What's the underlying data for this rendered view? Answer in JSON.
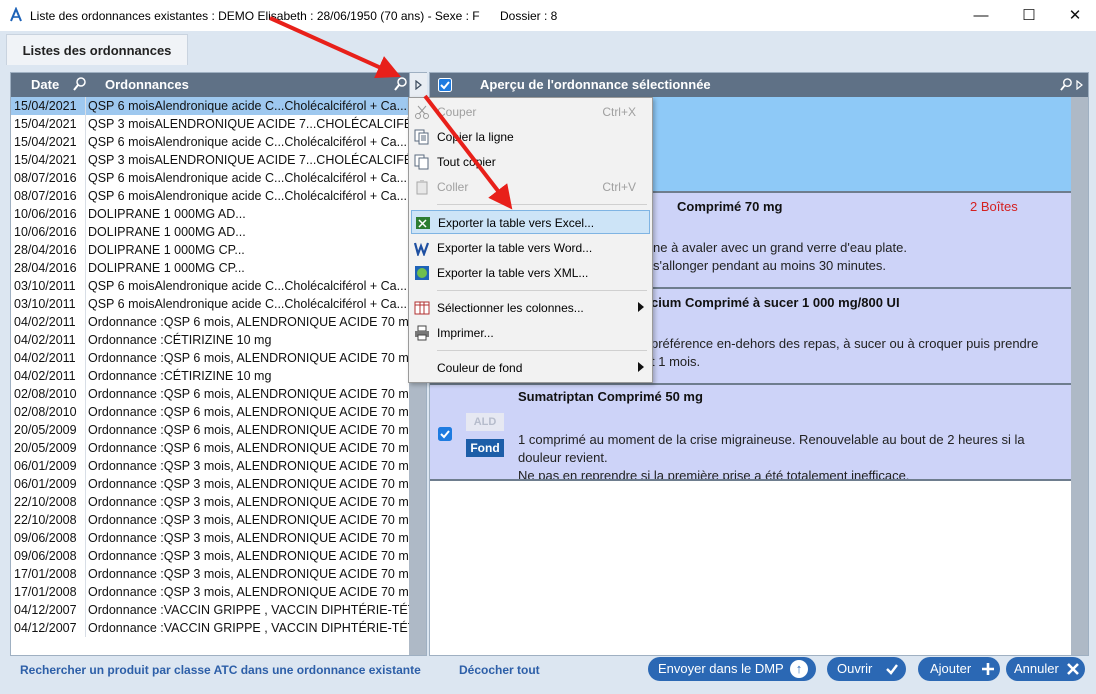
{
  "window": {
    "title": "Liste des ordonnances existantes : DEMO Elisabeth : 28/06/1950 (70 ans) - Sexe : F",
    "dossier": "Dossier : 8",
    "minimize": "—",
    "maximize": "☐",
    "close": "✕"
  },
  "tab": {
    "label": "Listes des ordonnances"
  },
  "left_table": {
    "col_date": "Date",
    "col_ordonnances": "Ordonnances",
    "rows": [
      {
        "date": "15/04/2021",
        "ord": "QSP 6 moisAlendronique acide C...Cholécalciférol + Ca..."
      },
      {
        "date": "15/04/2021",
        "ord": "QSP 3 moisALENDRONIQUE ACIDE 7...CHOLÉCALCIFÉR..."
      },
      {
        "date": "15/04/2021",
        "ord": "QSP 6 moisAlendronique acide C...Cholécalciférol + Ca..."
      },
      {
        "date": "15/04/2021",
        "ord": "QSP 3 moisALENDRONIQUE ACIDE 7...CHOLÉCALCIFÉR..."
      },
      {
        "date": "08/07/2016",
        "ord": "QSP 6 moisAlendronique acide C...Cholécalciférol + Ca..."
      },
      {
        "date": "08/07/2016",
        "ord": "QSP 6 moisAlendronique acide C...Cholécalciférol + Ca..."
      },
      {
        "date": "10/06/2016",
        "ord": "DOLIPRANE 1 000MG AD..."
      },
      {
        "date": "10/06/2016",
        "ord": "DOLIPRANE 1 000MG AD..."
      },
      {
        "date": "28/04/2016",
        "ord": "DOLIPRANE 1 000MG CP..."
      },
      {
        "date": "28/04/2016",
        "ord": "DOLIPRANE 1 000MG CP..."
      },
      {
        "date": "03/10/2011",
        "ord": "QSP 6 moisAlendronique acide C...Cholécalciférol + Ca..."
      },
      {
        "date": "03/10/2011",
        "ord": "QSP 6 moisAlendronique acide C...Cholécalciférol + Ca..."
      },
      {
        "date": "04/02/2011",
        "ord": "Ordonnance :QSP 6 mois, ALENDRONIQUE ACIDE 70 mg"
      },
      {
        "date": "04/02/2011",
        "ord": "Ordonnance :CÉTIRIZINE 10 mg"
      },
      {
        "date": "04/02/2011",
        "ord": "Ordonnance :QSP 6 mois, ALENDRONIQUE ACIDE 70 mg"
      },
      {
        "date": "04/02/2011",
        "ord": "Ordonnance :CÉTIRIZINE 10 mg"
      },
      {
        "date": "02/08/2010",
        "ord": "Ordonnance :QSP 6 mois, ALENDRONIQUE ACIDE 70 mg"
      },
      {
        "date": "02/08/2010",
        "ord": "Ordonnance :QSP 6 mois, ALENDRONIQUE ACIDE 70 mg"
      },
      {
        "date": "20/05/2009",
        "ord": "Ordonnance :QSP 6 mois, ALENDRONIQUE ACIDE 70 mg"
      },
      {
        "date": "20/05/2009",
        "ord": "Ordonnance :QSP 6 mois, ALENDRONIQUE ACIDE 70 mg"
      },
      {
        "date": "06/01/2009",
        "ord": "Ordonnance :QSP 3 mois, ALENDRONIQUE ACIDE 70 mg"
      },
      {
        "date": "06/01/2009",
        "ord": "Ordonnance :QSP 3 mois, ALENDRONIQUE ACIDE 70 mg"
      },
      {
        "date": "22/10/2008",
        "ord": "Ordonnance :QSP 3 mois, ALENDRONIQUE ACIDE 70 mg"
      },
      {
        "date": "22/10/2008",
        "ord": "Ordonnance :QSP 3 mois, ALENDRONIQUE ACIDE 70 mg"
      },
      {
        "date": "09/06/2008",
        "ord": "Ordonnance :QSP 3 mois, ALENDRONIQUE ACIDE 70 mg"
      },
      {
        "date": "09/06/2008",
        "ord": "Ordonnance :QSP 3 mois, ALENDRONIQUE ACIDE 70 mg"
      },
      {
        "date": "17/01/2008",
        "ord": "Ordonnance :QSP 3 mois, ALENDRONIQUE ACIDE 70 mg"
      },
      {
        "date": "17/01/2008",
        "ord": "Ordonnance :QSP 3 mois, ALENDRONIQUE ACIDE 70 mg"
      },
      {
        "date": "04/12/2007",
        "ord": "Ordonnance :VACCIN GRIPPE , VACCIN DIPHTÉRIE-TÉTANOS"
      },
      {
        "date": "04/12/2007",
        "ord": "Ordonnance :VACCIN GRIPPE , VACCIN DIPHTÉRIE-TÉTANOS"
      }
    ]
  },
  "preview": {
    "title": "Aperçu de l'ordonnance sélectionnée",
    "item2": {
      "title": "Comprimé 70 mg",
      "qty": "2 Boîtes",
      "line1": "ne à avaler avec un grand verre d'eau plate.",
      "line2": "s'allonger pendant au moins 30 minutes."
    },
    "item3": {
      "title": "cium Comprimé à sucer 1 000 mg/800 UI",
      "line1": "préférence en-dehors des repas, à sucer ou à croquer puis prendre",
      "line2": "t 1 mois."
    },
    "item4": {
      "title": "Sumatriptan Comprimé 50 mg",
      "badge_ald": "ALD",
      "badge_fond": "Fond",
      "line1": "1 comprimé au moment de la crise migraineuse. Renouvelable au bout de 2 heures si la",
      "line2": "douleur revient.",
      "line3": "Ne pas en reprendre si la première prise a été totalement inefficace."
    }
  },
  "context_menu": {
    "couper": "Couper",
    "couper_sc": "Ctrl+X",
    "copier_ligne": "Copier la ligne",
    "tout_copier": "Tout copier",
    "coller": "Coller",
    "coller_sc": "Ctrl+V",
    "export_excel": "Exporter la table vers Excel...",
    "export_word": "Exporter la table vers Word...",
    "export_xml": "Exporter la table vers XML...",
    "sel_colonnes": "Sélectionner les colonnes...",
    "imprimer": "Imprimer...",
    "couleur_fond": "Couleur de fond"
  },
  "footer": {
    "link_atc": "Rechercher un produit par classe ATC dans une ordonnance existante",
    "link_decocher": "Décocher tout",
    "btn_dmp": "Envoyer dans le DMP",
    "btn_ouvrir": "Ouvrir",
    "btn_ajouter": "Ajouter",
    "btn_annuler": "Annuler"
  },
  "colors": {
    "header": "#5f7186",
    "selected_row": "#9ec8ef",
    "preview_selected": "#8ec9f7",
    "preview_item": "#cdd3f8",
    "button": "#2b68b4",
    "annotation_arrow": "#e8201a"
  }
}
